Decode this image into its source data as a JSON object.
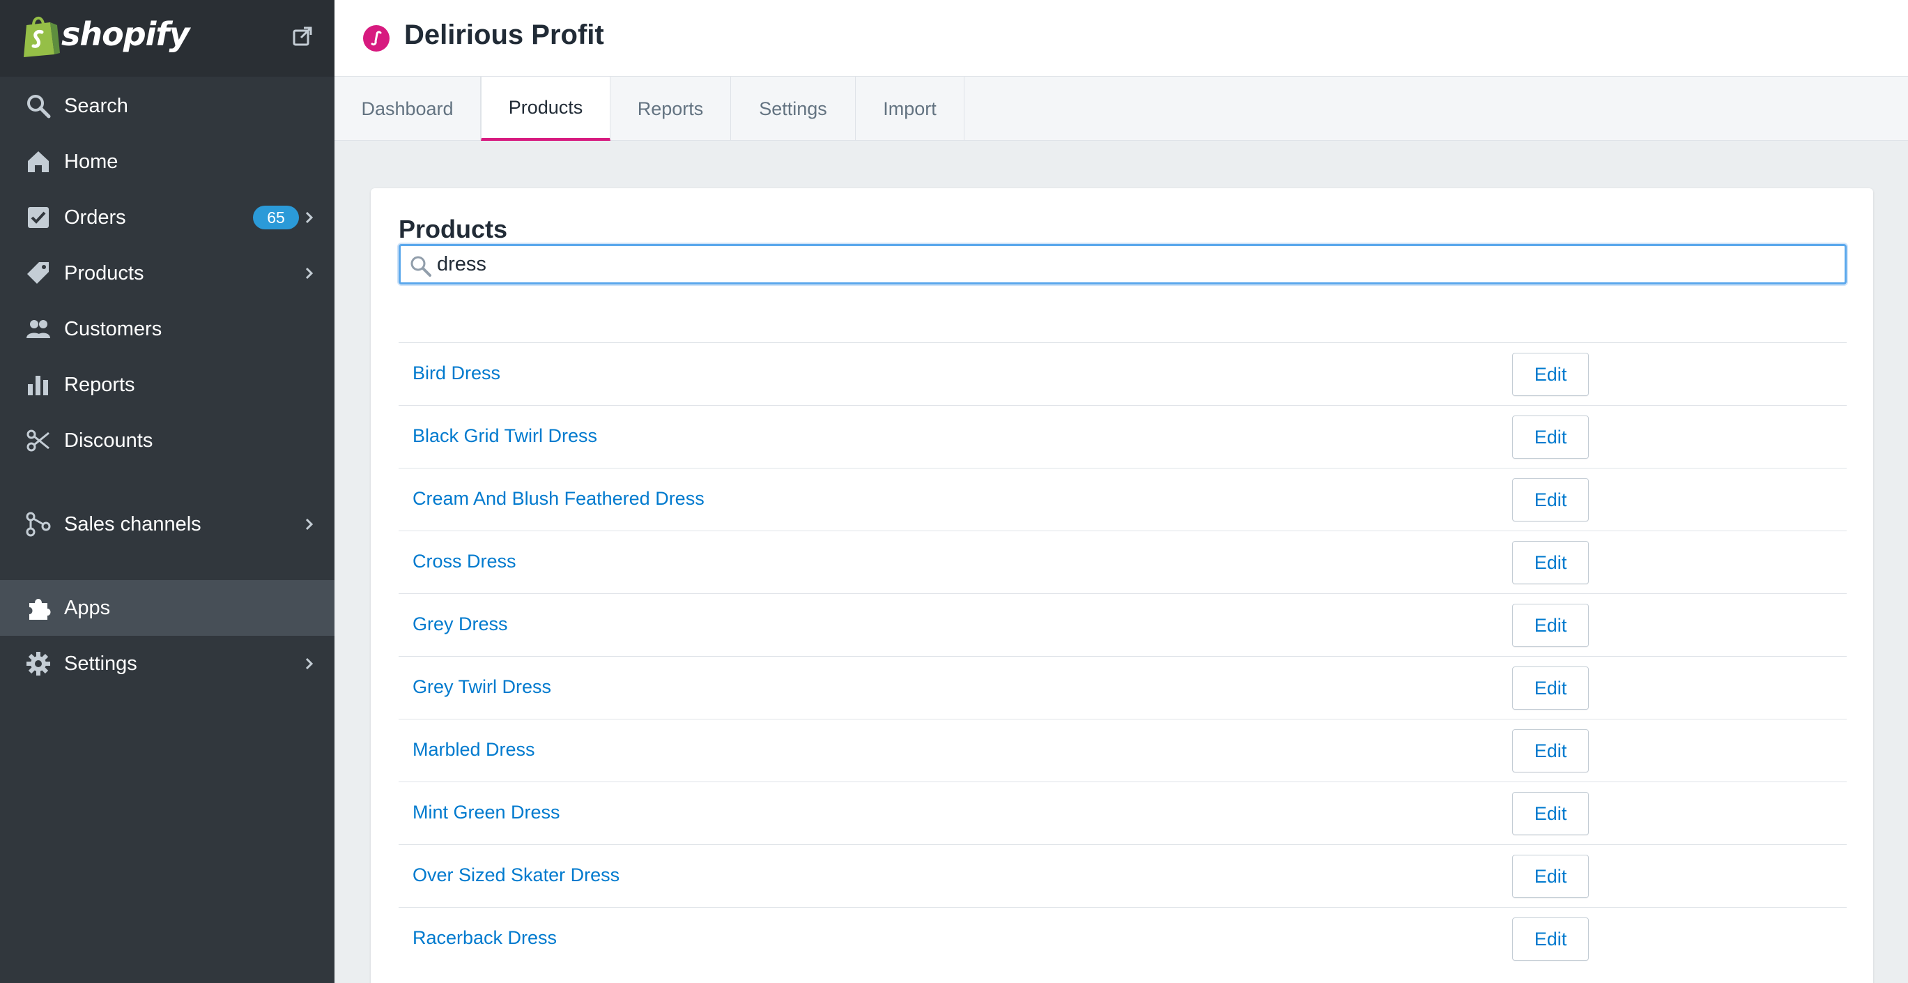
{
  "brand": {
    "name": "shopify"
  },
  "sidebar": {
    "items": [
      {
        "label": "Search",
        "icon": "search-icon"
      },
      {
        "label": "Home",
        "icon": "home-icon"
      },
      {
        "label": "Orders",
        "icon": "orders-icon",
        "badge": "65"
      },
      {
        "label": "Products",
        "icon": "tag-icon"
      },
      {
        "label": "Customers",
        "icon": "customers-icon"
      },
      {
        "label": "Reports",
        "icon": "bar-chart-icon"
      },
      {
        "label": "Discounts",
        "icon": "discount-icon"
      },
      {
        "label": "Sales channels",
        "icon": "sales-channels-icon"
      },
      {
        "label": "Apps",
        "icon": "puzzle-icon",
        "active": true
      },
      {
        "label": "Settings",
        "icon": "gear-icon"
      }
    ]
  },
  "header": {
    "title": "Delirious Profit"
  },
  "tabs": [
    {
      "label": "Dashboard"
    },
    {
      "label": "Products",
      "active": true
    },
    {
      "label": "Reports"
    },
    {
      "label": "Settings"
    },
    {
      "label": "Import"
    }
  ],
  "main": {
    "title": "Products",
    "search": {
      "value": "dress"
    },
    "edit_label": "Edit",
    "products": [
      "Bird Dress",
      "Black Grid Twirl Dress",
      "Cream And Blush Feathered Dress",
      "Cross Dress",
      "Grey Dress",
      "Grey Twirl Dress",
      "Marbled Dress",
      "Mint Green Dress",
      "Over Sized Skater Dress",
      "Racerback Dress"
    ]
  },
  "colors": {
    "sidebar_bg": "#31373d",
    "active_item_bg": "#474f57",
    "badge": "#2b9ad8",
    "link": "#007ace",
    "tab_accent": "#d71a7f"
  }
}
